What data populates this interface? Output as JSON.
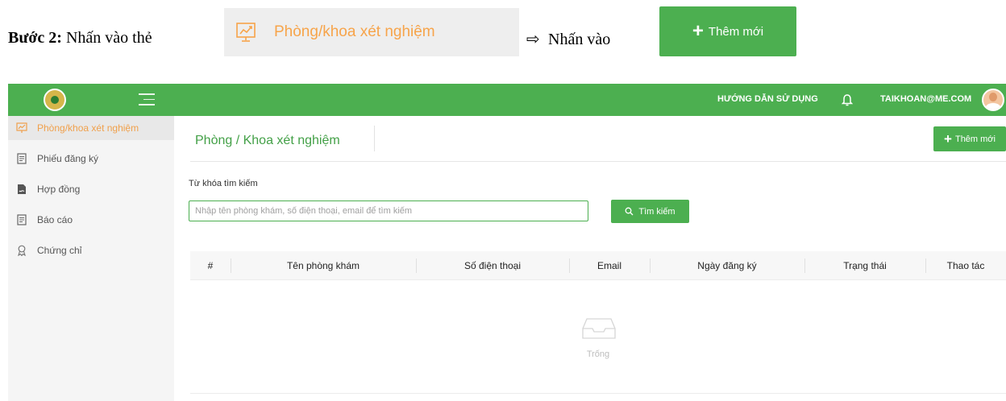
{
  "instruction": {
    "step_label": "Bước 2:",
    "text_tap": "Nhấn vào thẻ",
    "tab_label": "Phòng/khoa xét nghiệm",
    "arrow": "⇨",
    "text_press": "Nhấn vào",
    "add_label": "Thêm mới",
    "tab_color": "#f7a44a"
  },
  "header": {
    "guide": "HƯỚNG DẪN SỬ DỤNG",
    "account": "TAIKHOAN@ME.COM",
    "brand_color": "#4caf50"
  },
  "sidebar": {
    "items": [
      {
        "label": "Phòng/khoa xét nghiệm",
        "icon": "chart-icon",
        "active": true
      },
      {
        "label": "Phiếu đăng ký",
        "icon": "document-icon"
      },
      {
        "label": "Hợp đồng",
        "icon": "contract-icon"
      },
      {
        "label": "Báo cáo",
        "icon": "report-icon"
      },
      {
        "label": "Chứng chỉ",
        "icon": "certificate-icon"
      }
    ]
  },
  "main": {
    "title": "Phòng / Khoa xét nghiệm",
    "add_button": "Thêm mới",
    "search_label": "Từ khóa tìm kiếm",
    "search_placeholder": "Nhập tên phòng khám, số điện thoại, email để tìm kiếm",
    "search_button": "Tìm kiếm",
    "columns": [
      "#",
      "Tên phòng khám",
      "Số điện thoại",
      "Email",
      "Ngày đăng ký",
      "Trạng thái",
      "Thao tác"
    ],
    "empty_text": "Trống"
  }
}
